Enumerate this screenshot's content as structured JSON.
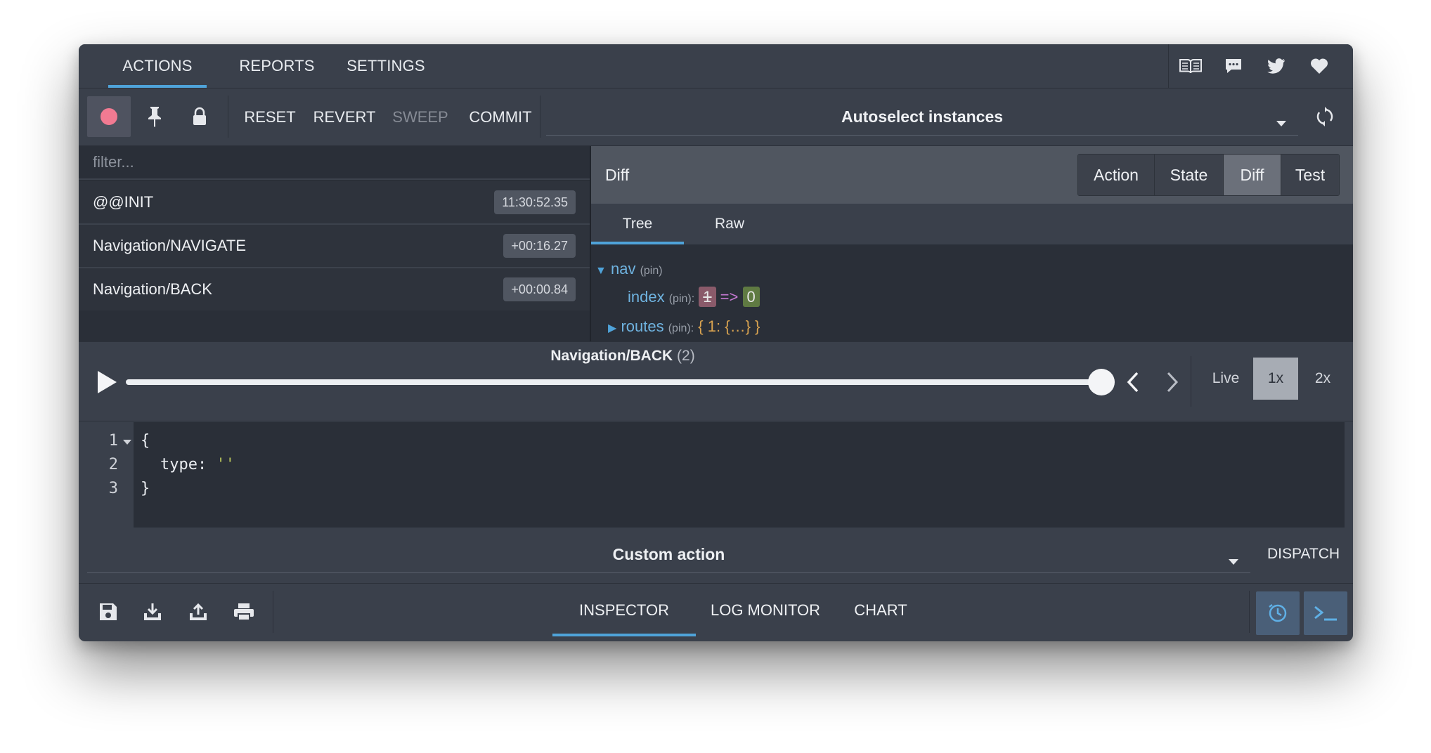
{
  "top_tabs": [
    "ACTIONS",
    "REPORTS",
    "SETTINGS"
  ],
  "top_icons": [
    "book-icon",
    "chat-icon",
    "twitter-icon",
    "heart-icon"
  ],
  "toolbar": {
    "buttons": [
      "RESET",
      "REVERT",
      "SWEEP",
      "COMMIT"
    ],
    "instance_select": "Autoselect instances"
  },
  "filter": {
    "placeholder": "filter..."
  },
  "actions": [
    {
      "name": "@@INIT",
      "time": "11:30:52.35"
    },
    {
      "name": "Navigation/NAVIGATE",
      "time": "+00:16.27"
    },
    {
      "name": "Navigation/BACK",
      "time": "+00:00.84"
    }
  ],
  "diff": {
    "title": "Diff",
    "views": [
      "Action",
      "State",
      "Diff",
      "Test"
    ],
    "active_view": "Diff",
    "subtabs": [
      "Tree",
      "Raw"
    ],
    "tree": {
      "root_key": "nav",
      "pin": "(pin)",
      "index_key": "index",
      "index_pin": "(pin):",
      "old_value": "1",
      "arrow": "=>",
      "new_value": "0",
      "routes_key": "routes",
      "routes_pin": "(pin):",
      "routes_value": "{ 1: {…} }"
    }
  },
  "slider": {
    "action_label": "Navigation/BACK",
    "count": "(2)",
    "position": 1.0,
    "speeds": [
      "Live",
      "1x",
      "2x"
    ],
    "active_speed": "1x"
  },
  "editor": {
    "line_numbers": [
      "1",
      "2",
      "3"
    ],
    "line1": "{",
    "line2_key": "type:",
    "line2_value": "''",
    "line3": "}"
  },
  "custom_action": {
    "label": "Custom action",
    "dispatch": "DISPATCH"
  },
  "bottom_tabs": [
    "INSPECTOR",
    "LOG MONITOR",
    "CHART"
  ],
  "colors": {
    "accent": "#4fa3d9",
    "record": "#f27a92"
  }
}
